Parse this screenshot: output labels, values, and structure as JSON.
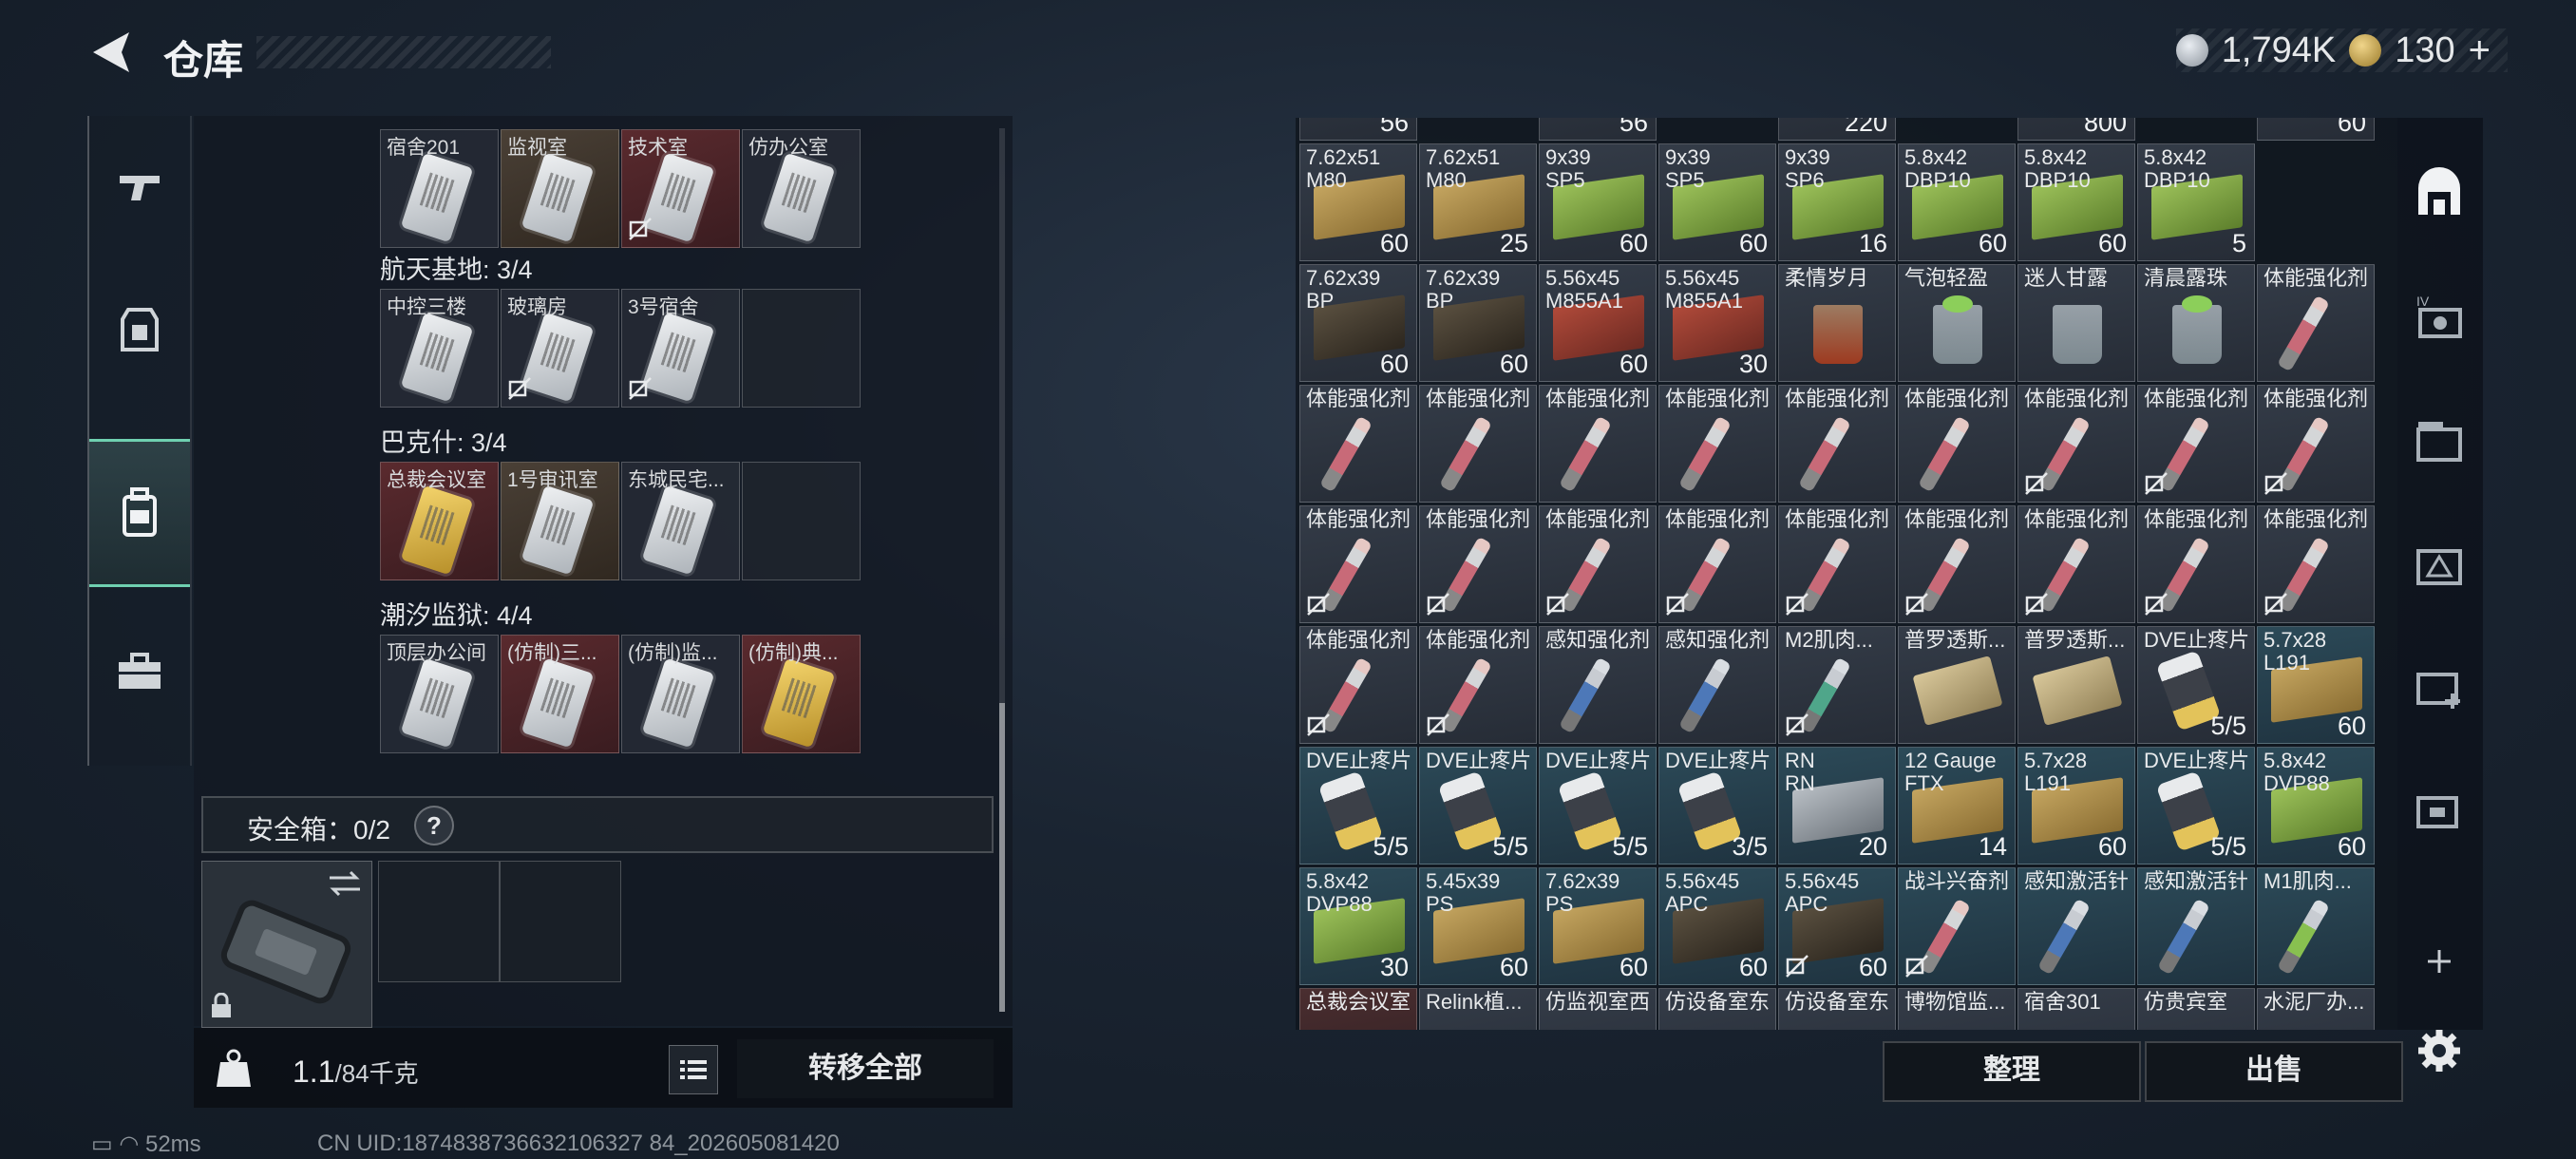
{
  "header": {
    "title": "仓库"
  },
  "currency": {
    "silver": "1,794K",
    "gold": "130",
    "add": "+"
  },
  "left_groups": [
    {
      "title": "",
      "slots": [
        {
          "label": "宿舍201",
          "bg": "plain",
          "nosell": false
        },
        {
          "label": "监视室",
          "bg": "brown",
          "nosell": false
        },
        {
          "label": "技术室",
          "bg": "red",
          "nosell": true
        },
        {
          "label": "仿办公室",
          "bg": "plain",
          "nosell": false
        }
      ]
    },
    {
      "title": "航天基地: 3/4",
      "slots": [
        {
          "label": "中控三楼",
          "bg": "plain",
          "nosell": false
        },
        {
          "label": "玻璃房",
          "bg": "plain",
          "nosell": true
        },
        {
          "label": "3号宿舍",
          "bg": "plain",
          "nosell": true
        },
        {
          "label": "",
          "bg": "empty",
          "nosell": false
        }
      ]
    },
    {
      "title": "巴克什: 3/4",
      "slots": [
        {
          "label": "总裁会议室",
          "bg": "red",
          "nosell": false,
          "gold": true
        },
        {
          "label": "1号审讯室",
          "bg": "brown",
          "nosell": false
        },
        {
          "label": "东城民宅...",
          "bg": "plain",
          "nosell": false
        },
        {
          "label": "",
          "bg": "empty",
          "nosell": false
        }
      ]
    },
    {
      "title": "潮汐监狱: 4/4",
      "slots": [
        {
          "label": "顶层办公间",
          "bg": "plain",
          "nosell": false
        },
        {
          "label": "(仿制)三...",
          "bg": "red",
          "nosell": false
        },
        {
          "label": "(仿制)监...",
          "bg": "plain",
          "nosell": false
        },
        {
          "label": "(仿制)典...",
          "bg": "red",
          "nosell": false,
          "gold": true
        }
      ]
    }
  ],
  "safe_box": {
    "label": "安全箱：0/2",
    "help": "?"
  },
  "weight": {
    "current": "1.1",
    "max": "/84千克"
  },
  "transfer_all": "转移全部",
  "top_row_partial": [
    "56",
    "56",
    "220",
    "800",
    "60"
  ],
  "inventory": [
    [
      {
        "name": "7.62x51\nM80",
        "qty": "60",
        "icon": "ammo-tan"
      },
      {
        "name": "7.62x51\nM80",
        "qty": "25",
        "icon": "ammo-tan"
      },
      {
        "name": "9x39\nSP5",
        "qty": "60",
        "icon": "ammo-green"
      },
      {
        "name": "9x39\nSP5",
        "qty": "60",
        "icon": "ammo-green"
      },
      {
        "name": "9x39\nSP6",
        "qty": "16",
        "icon": "ammo-green"
      },
      {
        "name": "5.8x42\nDBP10",
        "qty": "60",
        "icon": "ammo-green"
      },
      {
        "name": "5.8x42\nDBP10",
        "qty": "60",
        "icon": "ammo-green"
      },
      {
        "name": "5.8x42\nDBP10",
        "qty": "5",
        "icon": "ammo-green"
      }
    ],
    [
      {
        "name": "7.62x39\nBP",
        "qty": "60",
        "icon": "ammo-dark"
      },
      {
        "name": "7.62x39\nBP",
        "qty": "60",
        "icon": "ammo-dark"
      },
      {
        "name": "5.56x45\nM855A1",
        "qty": "60",
        "icon": "ammo-red"
      },
      {
        "name": "5.56x45\nM855A1",
        "qty": "30",
        "icon": "ammo-red"
      },
      {
        "name": "柔情岁月",
        "qty": "",
        "icon": "glass-amber"
      },
      {
        "name": "气泡轻盈",
        "qty": "",
        "icon": "glass-mint"
      },
      {
        "name": "迷人甘露",
        "qty": "",
        "icon": "glass"
      },
      {
        "name": "清晨露珠",
        "qty": "",
        "icon": "glass-mint"
      },
      {
        "name": "体能强化剂",
        "qty": "",
        "icon": "syringe-red"
      }
    ],
    [
      {
        "name": "体能强化剂",
        "qty": "",
        "icon": "syringe-red"
      },
      {
        "name": "体能强化剂",
        "qty": "",
        "icon": "syringe-red"
      },
      {
        "name": "体能强化剂",
        "qty": "",
        "icon": "syringe-red"
      },
      {
        "name": "体能强化剂",
        "qty": "",
        "icon": "syringe-red"
      },
      {
        "name": "体能强化剂",
        "qty": "",
        "icon": "syringe-red"
      },
      {
        "name": "体能强化剂",
        "qty": "",
        "icon": "syringe-red"
      },
      {
        "name": "体能强化剂",
        "qty": "",
        "icon": "syringe-red",
        "nosell": true
      },
      {
        "name": "体能强化剂",
        "qty": "",
        "icon": "syringe-red",
        "nosell": true
      },
      {
        "name": "体能强化剂",
        "qty": "",
        "icon": "syringe-red",
        "nosell": true
      }
    ],
    [
      {
        "name": "体能强化剂",
        "qty": "",
        "icon": "syringe-red",
        "nosell": true
      },
      {
        "name": "体能强化剂",
        "qty": "",
        "icon": "syringe-red",
        "nosell": true
      },
      {
        "name": "体能强化剂",
        "qty": "",
        "icon": "syringe-red",
        "nosell": true
      },
      {
        "name": "体能强化剂",
        "qty": "",
        "icon": "syringe-red",
        "nosell": true
      },
      {
        "name": "体能强化剂",
        "qty": "",
        "icon": "syringe-red",
        "nosell": true
      },
      {
        "name": "体能强化剂",
        "qty": "",
        "icon": "syringe-red",
        "nosell": true
      },
      {
        "name": "体能强化剂",
        "qty": "",
        "icon": "syringe-red",
        "nosell": true
      },
      {
        "name": "体能强化剂",
        "qty": "",
        "icon": "syringe-red",
        "nosell": true
      },
      {
        "name": "体能强化剂",
        "qty": "",
        "icon": "syringe-red",
        "nosell": true
      }
    ],
    [
      {
        "name": "体能强化剂",
        "qty": "",
        "icon": "syringe-red",
        "nosell": true
      },
      {
        "name": "体能强化剂",
        "qty": "",
        "icon": "syringe-red",
        "nosell": true
      },
      {
        "name": "感知强化剂",
        "qty": "",
        "icon": "syringe-blue"
      },
      {
        "name": "感知强化剂",
        "qty": "",
        "icon": "syringe-blue"
      },
      {
        "name": "M2肌肉...",
        "qty": "",
        "icon": "syringe-green",
        "nosell": true
      },
      {
        "name": "普罗透斯...",
        "qty": "",
        "icon": "pack"
      },
      {
        "name": "普罗透斯...",
        "qty": "",
        "icon": "pack"
      },
      {
        "name": "DVE止疼片",
        "qty": "5/5",
        "icon": "pills"
      },
      {
        "name": "5.7x28\nL191",
        "qty": "60",
        "icon": "ammo-tan",
        "teal": true
      }
    ],
    [
      {
        "name": "DVE止疼片",
        "qty": "5/5",
        "icon": "pills",
        "teal": true
      },
      {
        "name": "DVE止疼片",
        "qty": "5/5",
        "icon": "pills",
        "teal": true
      },
      {
        "name": "DVE止疼片",
        "qty": "5/5",
        "icon": "pills",
        "teal": true
      },
      {
        "name": "DVE止疼片",
        "qty": "3/5",
        "icon": "pills",
        "teal": true
      },
      {
        "name": "RN\nRN",
        "qty": "20",
        "icon": "ammo-grey",
        "teal": true
      },
      {
        "name": "12 Gauge\nFTX",
        "qty": "14",
        "icon": "ammo-tan",
        "teal": true
      },
      {
        "name": "5.7x28\nL191",
        "qty": "60",
        "icon": "ammo-tan",
        "teal": true
      },
      {
        "name": "DVE止疼片",
        "qty": "5/5",
        "icon": "pills",
        "teal": true
      },
      {
        "name": "5.8x42\nDVP88",
        "qty": "60",
        "icon": "ammo-green",
        "teal": true
      }
    ],
    [
      {
        "name": "5.8x42\nDVP88",
        "qty": "30",
        "icon": "ammo-green",
        "teal": true
      },
      {
        "name": "5.45x39\nPS",
        "qty": "60",
        "icon": "ammo-tan",
        "teal": true
      },
      {
        "name": "7.62x39\nPS",
        "qty": "60",
        "icon": "ammo-tan",
        "teal": true
      },
      {
        "name": "5.56x45\nAPC",
        "qty": "60",
        "icon": "ammo-dark",
        "teal": true
      },
      {
        "name": "5.56x45\nAPC",
        "qty": "60",
        "icon": "ammo-dark",
        "teal": true,
        "nosell": true
      },
      {
        "name": "战斗兴奋剂",
        "qty": "",
        "icon": "syringe-red",
        "teal": true,
        "nosell": true
      },
      {
        "name": "感知激活针",
        "qty": "",
        "icon": "syringe-blue",
        "teal": true
      },
      {
        "name": "感知激活针",
        "qty": "",
        "icon": "syringe-blue",
        "teal": true
      },
      {
        "name": "M1肌肉...",
        "qty": "",
        "icon": "syringe-lime",
        "teal": true
      }
    ],
    [
      {
        "name": "总裁会议室",
        "qty": "",
        "icon": "",
        "red": true
      },
      {
        "name": "Relink植...",
        "qty": "",
        "icon": ""
      },
      {
        "name": "仿监视室西",
        "qty": "",
        "icon": ""
      },
      {
        "name": "仿设备室东",
        "qty": "",
        "icon": ""
      },
      {
        "name": "仿设备室东",
        "qty": "",
        "icon": ""
      },
      {
        "name": "博物馆监...",
        "qty": "",
        "icon": ""
      },
      {
        "name": "宿舍301",
        "qty": "",
        "icon": ""
      },
      {
        "name": "仿贵宾室",
        "qty": "",
        "icon": ""
      },
      {
        "name": "水泥厂办...",
        "qty": "",
        "icon": ""
      }
    ]
  ],
  "buttons": {
    "organize": "整理",
    "sell": "出售"
  },
  "status": {
    "ping": "52ms",
    "uid": "CN UID:1874838736632106327 84_202605081420"
  }
}
